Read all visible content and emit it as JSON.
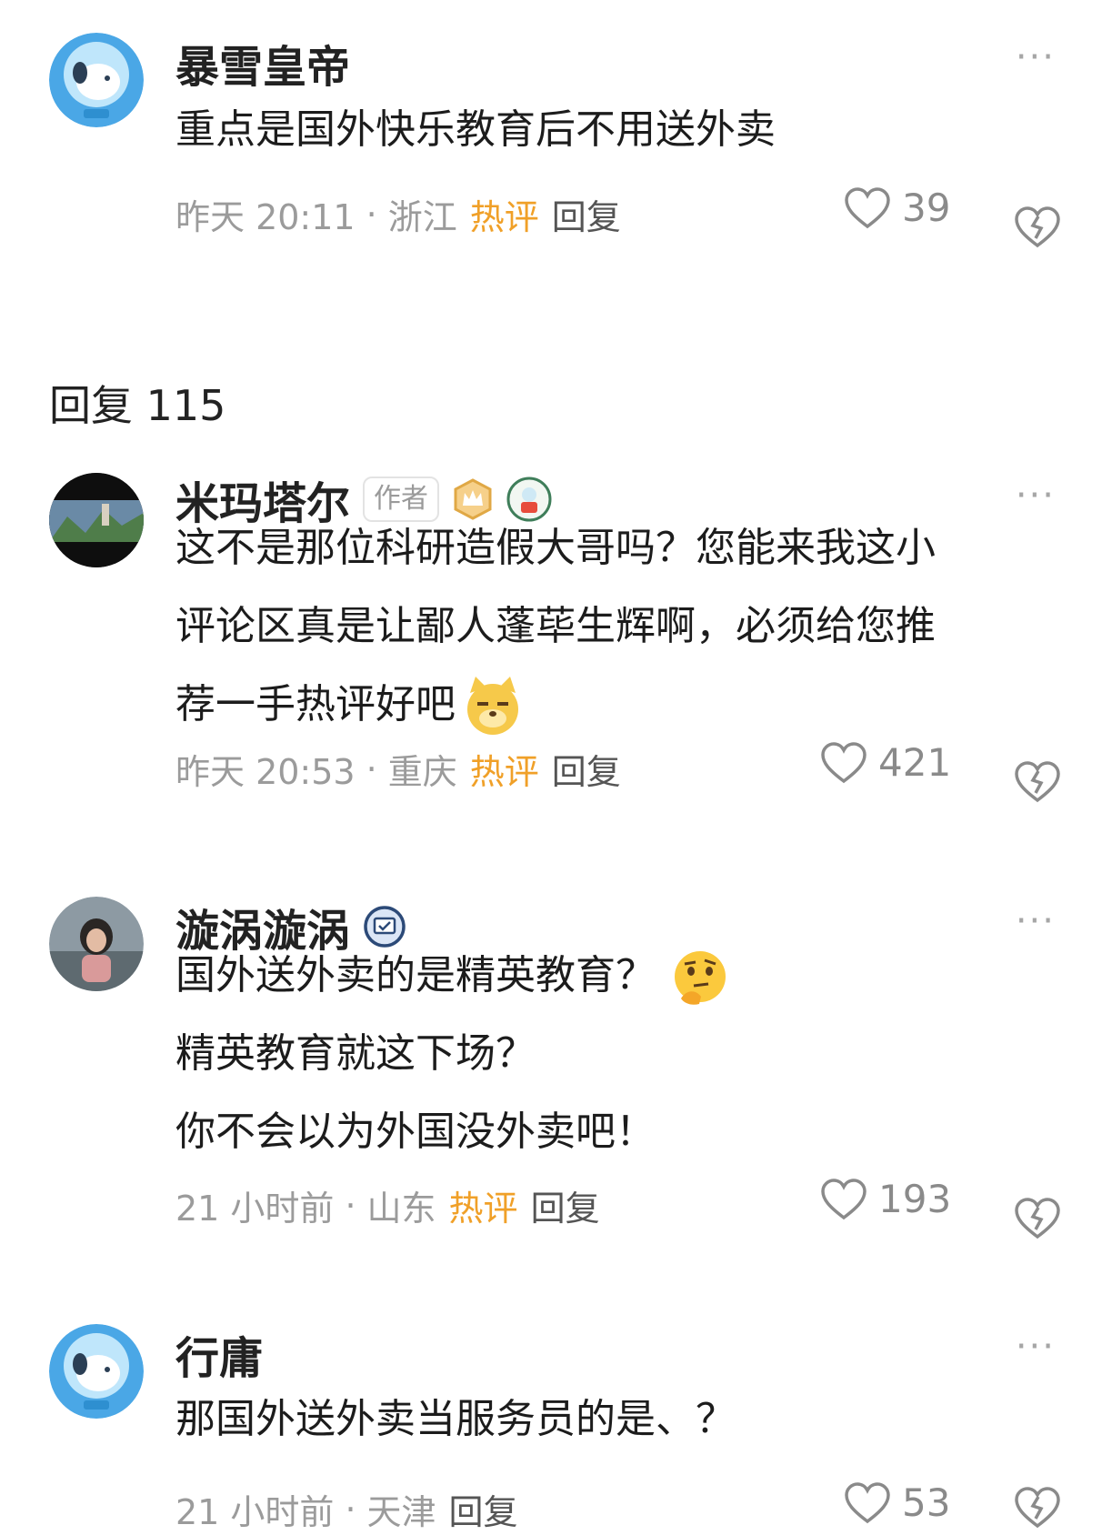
{
  "root_comment": {
    "username": "暴雪皇帝",
    "text": "重点是国外快乐教育后不用送外卖",
    "time": "昨天 20:11",
    "location": "浙江",
    "hot_label": "热评",
    "reply_label": "回复",
    "likes": "39",
    "more_label": "···"
  },
  "replies_header": {
    "label": "回复",
    "count": "115"
  },
  "replies": [
    {
      "username": "米玛塔尔",
      "author_badge": "作者",
      "lines": [
        "这不是那位科研造假大哥吗？您能来我这小",
        "评论区真是让鄙人蓬荜生辉啊，必须给您推",
        "荐一手热评好吧"
      ],
      "time": "昨天 20:53",
      "location": "重庆",
      "hot_label": "热评",
      "reply_label": "回复",
      "likes": "421",
      "more_label": "···"
    },
    {
      "username": "漩涡漩涡",
      "lines": [
        "国外送外卖的是精英教育？",
        "精英教育就这下场？",
        "你不会以为外国没外卖吧！"
      ],
      "time": "21 小时前",
      "location": "山东",
      "hot_label": "热评",
      "reply_label": "回复",
      "likes": "193",
      "more_label": "···"
    },
    {
      "username": "行庸",
      "lines": [
        "那国外送外卖当服务员的是、？"
      ],
      "time": "21 小时前",
      "location": "天津",
      "reply_label": "回复",
      "likes": "53",
      "more_label": "···"
    }
  ],
  "colors": {
    "hot": "#f0a028",
    "meta": "#9b9b9b",
    "name": "#222222"
  },
  "icons": [
    "more-icon",
    "heart-icon",
    "dislike-heart-icon",
    "vip-crown-icon",
    "medal-icon",
    "verified-icon",
    "dog-emoji-icon",
    "thinking-emoji-icon"
  ]
}
